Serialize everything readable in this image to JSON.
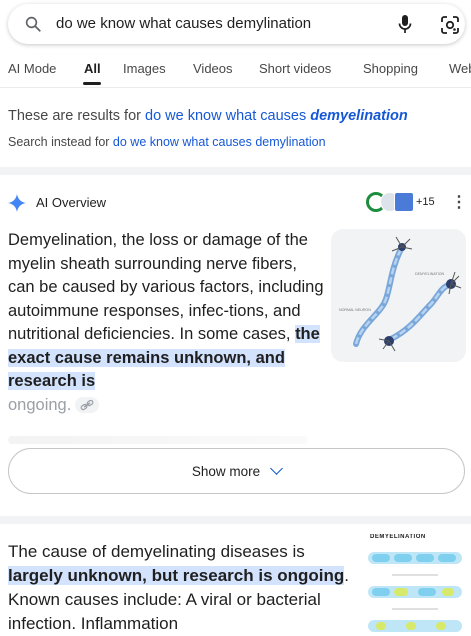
{
  "search": {
    "query": "do we know what causes demylination"
  },
  "tabs": [
    "AI Mode",
    "All",
    "Images",
    "Videos",
    "Short videos",
    "Shopping",
    "Web"
  ],
  "correction": {
    "prefix": "These are results for ",
    "corrected_plain": "do we know what causes ",
    "corrected_emph": "demyelination",
    "instead_prefix": "Search instead for ",
    "instead_link": "do we know what causes demylination"
  },
  "ai_overview": {
    "label": "AI Overview",
    "sources_more": "+15",
    "text_plain": "Demyelination, the loss or damage of the myelin sheath surrounding nerve fibers, can be caused by various factors, including autoimmune responses, infec-tions, and nutritional deficiencies. In some cases, ",
    "text_highlight": "the exact cause remains unknown, and research is",
    "text_fade": "ongoing",
    "text_fade_end": ".",
    "image_caption_top": "DEMYELINATION",
    "image_caption_bottom": "NORMAL NEURON",
    "show_more": "Show more"
  },
  "result": {
    "text_before": "The cause of demyelinating diseases is ",
    "text_highlight": "largely unknown, but research is ongoing",
    "text_after": ". Known causes include: A viral or bacterial infection. Inflammation",
    "image_header": "DEMYELINATION"
  },
  "colors": {
    "accent": "#0b57d0",
    "link": "#1558d6",
    "highlight": "#d3e3fd"
  }
}
